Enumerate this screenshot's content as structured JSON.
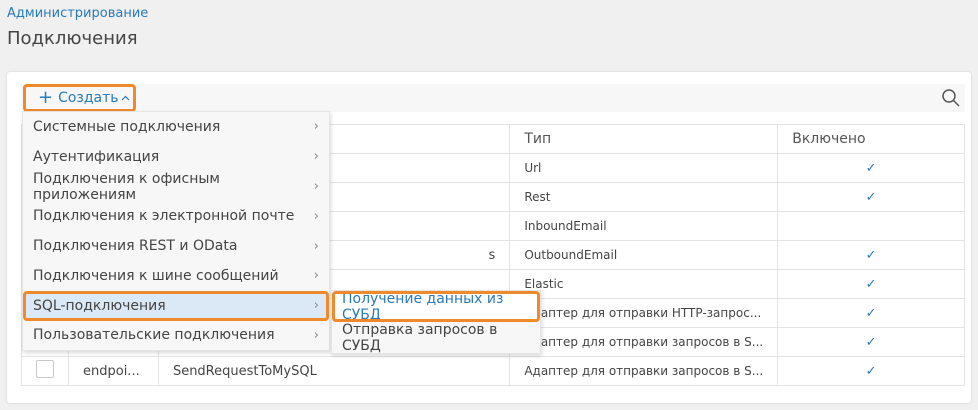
{
  "breadcrumb": "Администрирование",
  "page_title": "Подключения",
  "toolbar": {
    "create_label": "Создать",
    "plus_icon": "+",
    "caret_icon": "^"
  },
  "table": {
    "headers": [
      "",
      "",
      "",
      "Тип",
      "Включено"
    ],
    "rows": [
      {
        "col1": "",
        "name": "",
        "type": "Url",
        "enabled": "✓"
      },
      {
        "col1": "",
        "name": "",
        "type": "Rest",
        "enabled": "✓"
      },
      {
        "col1": "",
        "name": "",
        "type": "InboundEmail",
        "enabled": ""
      },
      {
        "col1": "",
        "name": "s",
        "type": "OutboundEmail",
        "enabled": "✓"
      },
      {
        "col1": "",
        "name": "",
        "type": "Elastic",
        "enabled": "✓"
      },
      {
        "col1": "",
        "name": "",
        "type": "Адаптер для отправки HTTP-запрос...",
        "enabled": "✓"
      },
      {
        "col1": "",
        "name": "",
        "type": "Адаптер для отправки запросов в S...",
        "enabled": "✓"
      },
      {
        "col1": "endpoi...",
        "name": "SendRequestToMySQL",
        "type": "Адаптер для отправки запросов в S...",
        "enabled": "✓"
      }
    ]
  },
  "menu": {
    "items": [
      {
        "label": "Системные подключения",
        "chev": "›"
      },
      {
        "label": "Аутентификация",
        "chev": "›"
      },
      {
        "label": "Подключения к офисным приложениям",
        "chev": "›"
      },
      {
        "label": "Подключения к электронной почте",
        "chev": "›"
      },
      {
        "label": "Подключения REST и OData",
        "chev": "›"
      },
      {
        "label": "Подключения к шине сообщений",
        "chev": "›"
      },
      {
        "label": "SQL-подключения",
        "chev": "›"
      },
      {
        "label": "Пользовательские подключения",
        "chev": "›"
      }
    ]
  },
  "submenu": {
    "items": [
      {
        "label": "Получение данных из СУБД"
      },
      {
        "label": "Отправка запросов в СУБД"
      }
    ]
  },
  "colors": {
    "accent": "#2a7ab8",
    "highlight": "#ef8a2c"
  }
}
